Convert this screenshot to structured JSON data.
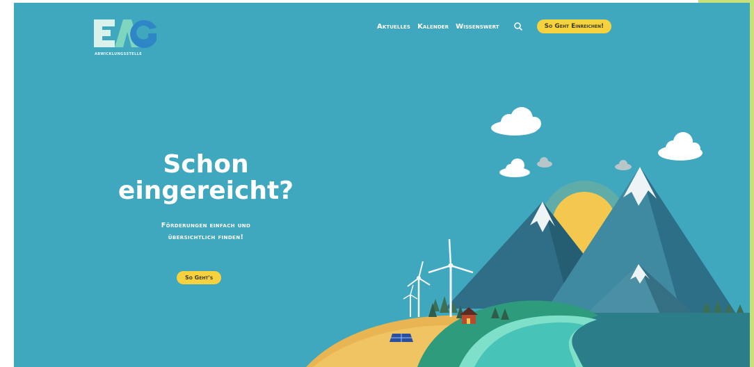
{
  "logo": {
    "letters": "EAG",
    "subtitle": "ABWICKLUNGSSTELLE"
  },
  "nav": {
    "items": [
      "Aktuelles",
      "Kalender",
      "Wissenswert"
    ],
    "search_icon": "search-icon",
    "cta_label": "So Geht Einreichen!"
  },
  "hero": {
    "headline_line1": "Schon",
    "headline_line2": "eingereicht?",
    "sub_line1": "Förderungen einfach und",
    "sub_line2": "übersichtlich finden!",
    "button_label": "So Geht's"
  },
  "colors": {
    "background": "#3fa7be",
    "accent_yellow": "#f6d23f",
    "frame_green": "#c6e07a",
    "water": "#48c3b8",
    "sun": "#f4c84f"
  }
}
